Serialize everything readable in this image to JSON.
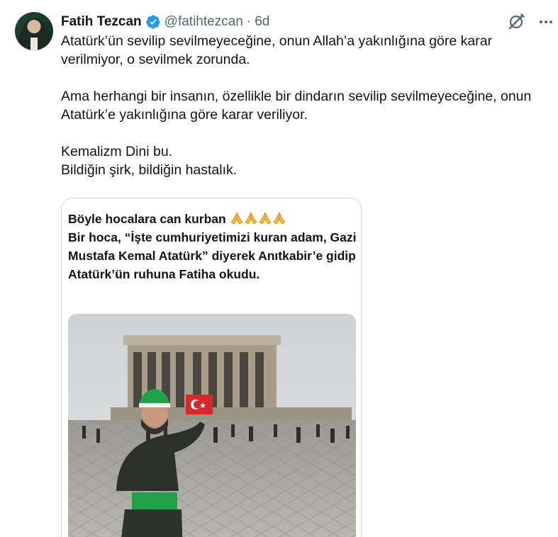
{
  "author": {
    "name": "Fatih Tezcan",
    "handle": "@fatihtezcan",
    "separator": "·",
    "time": "6d"
  },
  "icons": {
    "verified": "verified-badge-icon",
    "grok": "grok-icon",
    "more": "more-icon"
  },
  "tweet": {
    "lines": [
      "Atatürk’ün sevilip sevilmeyeceğine, onun Allah’a yakınlığına göre karar verilmiyor, o sevilmek zorunda.",
      "Ama herhangi bir insanın, özellikle bir dindarın sevilip sevilmeyeceğine, onun Atatürk’e yakınlığına göre karar veriliyor.",
      "Kemalizm Dini bu.",
      "Bildiğin şirk, bildiğin hastalık."
    ]
  },
  "quote": {
    "title": "Böyle hocalara can kurban",
    "body": "Bir hoca, “İşte cumhuriyetimizi kuran adam, Gazi Mustafa Kemal Atatürk” diyerek Anıtkabir’e gidip Atatürk’ün ruhuna Fatiha okudu.",
    "emoji_count": 4
  },
  "colors": {
    "text": "#0f1419",
    "secondary": "#536471",
    "verified": "#1d9bf0",
    "border": "#cfd9de"
  }
}
